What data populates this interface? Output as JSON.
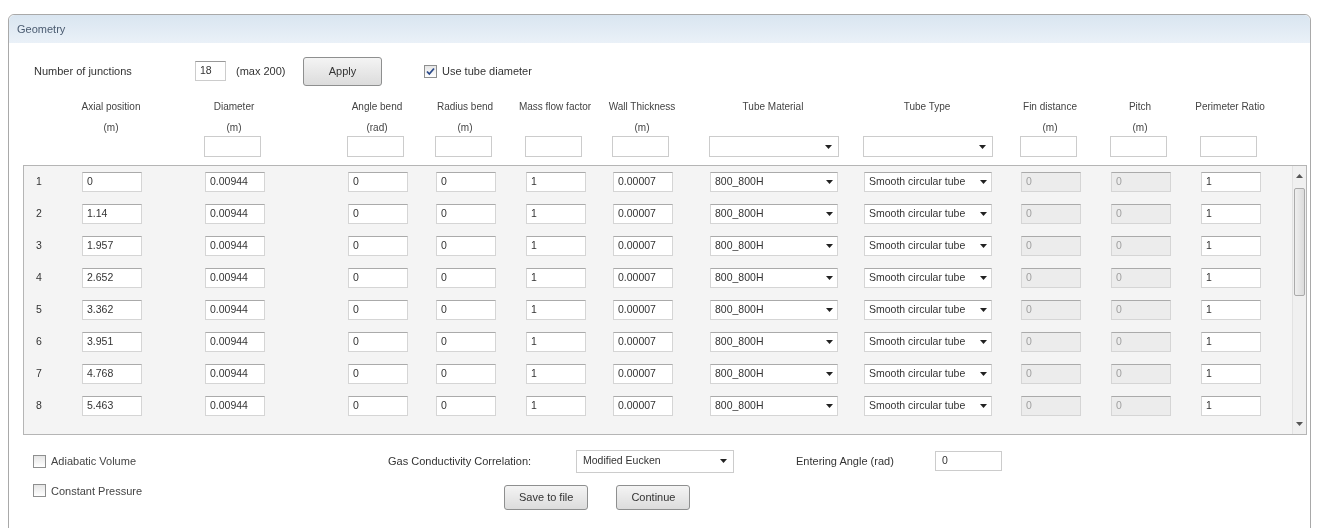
{
  "window": {
    "title": "Geometry"
  },
  "junctions": {
    "label": "Number of junctions",
    "value": "18",
    "hint": "(max 200)",
    "apply": "Apply",
    "use_tube_diameter": {
      "label": "Use tube diameter",
      "checked": true
    }
  },
  "columns": [
    {
      "title": "Axial position",
      "unit": "(m)",
      "kind": "text",
      "filter": false,
      "disabled": false
    },
    {
      "title": "Diameter",
      "unit": "(m)",
      "kind": "text",
      "filter": true,
      "disabled": false
    },
    {
      "title": "Angle bend",
      "unit": "(rad)",
      "kind": "text",
      "filter": true,
      "disabled": false
    },
    {
      "title": "Radius bend",
      "unit": "(m)",
      "kind": "text",
      "filter": true,
      "disabled": false
    },
    {
      "title": "Mass flow factor",
      "kind": "text",
      "filter": true,
      "disabled": false
    },
    {
      "title": "Wall Thickness",
      "unit": "(m)",
      "kind": "text",
      "filter": true,
      "disabled": false
    },
    {
      "title": "Tube Material",
      "kind": "select",
      "filter": true,
      "disabled": false
    },
    {
      "title": "Tube Type",
      "kind": "select",
      "filter": true,
      "disabled": false
    },
    {
      "title": "Fin distance",
      "unit": "(m)",
      "kind": "text",
      "filter": true,
      "disabled": true
    },
    {
      "title": "Pitch",
      "unit": "(m)",
      "kind": "text",
      "filter": true,
      "disabled": true
    },
    {
      "title": "Perimeter Ratio",
      "kind": "text",
      "filter": true,
      "disabled": false
    }
  ],
  "rows": [
    {
      "number": "1",
      "values": [
        "0",
        "0.00944",
        "0",
        "0",
        "1",
        "0.00007",
        "800_800H",
        "Smooth circular tube",
        "0",
        "0",
        "1"
      ]
    },
    {
      "number": "2",
      "values": [
        "1.14",
        "0.00944",
        "0",
        "0",
        "1",
        "0.00007",
        "800_800H",
        "Smooth circular tube",
        "0",
        "0",
        "1"
      ]
    },
    {
      "number": "3",
      "values": [
        "1.957",
        "0.00944",
        "0",
        "0",
        "1",
        "0.00007",
        "800_800H",
        "Smooth circular tube",
        "0",
        "0",
        "1"
      ]
    },
    {
      "number": "4",
      "values": [
        "2.652",
        "0.00944",
        "0",
        "0",
        "1",
        "0.00007",
        "800_800H",
        "Smooth circular tube",
        "0",
        "0",
        "1"
      ]
    },
    {
      "number": "5",
      "values": [
        "3.362",
        "0.00944",
        "0",
        "0",
        "1",
        "0.00007",
        "800_800H",
        "Smooth circular tube",
        "0",
        "0",
        "1"
      ]
    },
    {
      "number": "6",
      "values": [
        "3.951",
        "0.00944",
        "0",
        "0",
        "1",
        "0.00007",
        "800_800H",
        "Smooth circular tube",
        "0",
        "0",
        "1"
      ]
    },
    {
      "number": "7",
      "values": [
        "4.768",
        "0.00944",
        "0",
        "0",
        "1",
        "0.00007",
        "800_800H",
        "Smooth circular tube",
        "0",
        "0",
        "1"
      ]
    },
    {
      "number": "8",
      "values": [
        "5.463",
        "0.00944",
        "0",
        "0",
        "1",
        "0.00007",
        "800_800H",
        "Smooth circular tube",
        "0",
        "0",
        "1"
      ]
    }
  ],
  "options": [
    {
      "label": "Adiabatic Volume",
      "checked": false
    },
    {
      "label": "Constant Pressure",
      "checked": false
    }
  ],
  "gas_conductivity": {
    "label": "Gas Conductivity Correlation:",
    "value": "Modified Eucken"
  },
  "entering_angle": {
    "label": "Entering Angle (rad)",
    "value": "0"
  },
  "buttons": [
    "Save to file",
    "Continue"
  ]
}
